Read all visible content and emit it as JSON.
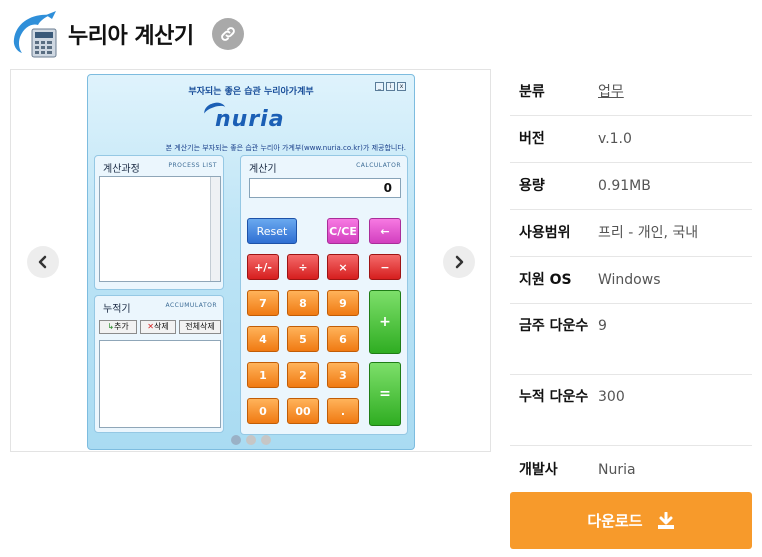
{
  "header": {
    "title": "누리아 계산기",
    "icon": "calculator-dolphin-icon",
    "link_icon": "link-icon"
  },
  "gallery": {
    "prev_icon": "chevron-left-icon",
    "next_icon": "chevron-right-icon",
    "dots_count": 3,
    "active_dot": 0
  },
  "calculator": {
    "tagline": "부자되는 좋은 습관 누리아가계부",
    "logo": "nuria",
    "notice": "본 계산기는 부자되는 좋은 습관 누리아 가계부(www.nuria.co.kr)가 제공합니다.",
    "process_panel": {
      "title": "계산과정",
      "subtitle": "PROCESS LIST"
    },
    "calc_panel": {
      "title": "계산기",
      "subtitle": "CALCULATOR",
      "display": "0"
    },
    "accumulator_panel": {
      "title": "누적기",
      "subtitle": "ACCUMULATOR",
      "buttons": {
        "add": "추가",
        "delete": "삭제",
        "delete_all": "전체삭제"
      }
    },
    "keys": {
      "reset": "Reset",
      "cce": "C/CE",
      "back": "←",
      "sign": "+/-",
      "div": "÷",
      "mul": "×",
      "minus": "−",
      "n7": "7",
      "n8": "8",
      "n9": "9",
      "plus": "+",
      "n4": "4",
      "n5": "5",
      "n6": "6",
      "n1": "1",
      "n2": "2",
      "n3": "3",
      "equals": "=",
      "n0": "0",
      "n00": "00",
      "dot": "."
    }
  },
  "info": {
    "rows": [
      {
        "label": "분류",
        "value": "업무"
      },
      {
        "label": "버전",
        "value": "v.1.0"
      },
      {
        "label": "용량",
        "value": "0.91MB"
      },
      {
        "label": "사용범위",
        "value": "프리 - 개인, 국내"
      },
      {
        "label": "지원 OS",
        "value": "Windows"
      },
      {
        "label": "금주 다운수",
        "value": "9"
      },
      {
        "label": "누적 다운수",
        "value": "300"
      },
      {
        "label": "개발사",
        "value": "Nuria"
      }
    ]
  },
  "download": {
    "label": "다운로드",
    "icon": "download-icon"
  },
  "colors": {
    "accent": "#f79a2b",
    "link_button": "#a9a9a9"
  }
}
